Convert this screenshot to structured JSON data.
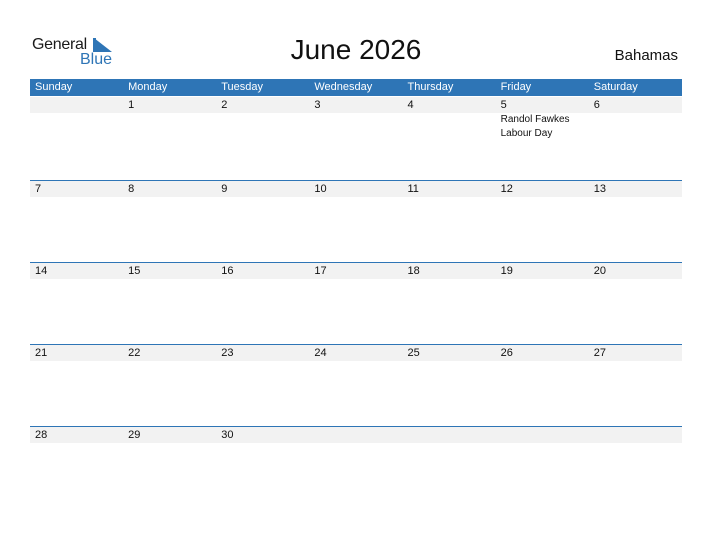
{
  "logo": {
    "general": "General",
    "blue": "Blue"
  },
  "title": "June 2026",
  "country": "Bahamas",
  "colors": {
    "accent": "#2e75b6",
    "strip": "#f2f2f2"
  },
  "weekdays": [
    "Sunday",
    "Monday",
    "Tuesday",
    "Wednesday",
    "Thursday",
    "Friday",
    "Saturday"
  ],
  "weeks": [
    {
      "days": [
        "",
        "1",
        "2",
        "3",
        "4",
        "5",
        "6"
      ],
      "events": [
        "",
        "",
        "",
        "",
        "",
        "Randol Fawkes\nLabour Day",
        ""
      ]
    },
    {
      "days": [
        "7",
        "8",
        "9",
        "10",
        "11",
        "12",
        "13"
      ],
      "events": [
        "",
        "",
        "",
        "",
        "",
        "",
        ""
      ]
    },
    {
      "days": [
        "14",
        "15",
        "16",
        "17",
        "18",
        "19",
        "20"
      ],
      "events": [
        "",
        "",
        "",
        "",
        "",
        "",
        ""
      ]
    },
    {
      "days": [
        "21",
        "22",
        "23",
        "24",
        "25",
        "26",
        "27"
      ],
      "events": [
        "",
        "",
        "",
        "",
        "",
        "",
        ""
      ]
    },
    {
      "days": [
        "28",
        "29",
        "30",
        "",
        "",
        "",
        ""
      ],
      "events": [
        "",
        "",
        "",
        "",
        "",
        "",
        ""
      ]
    }
  ]
}
